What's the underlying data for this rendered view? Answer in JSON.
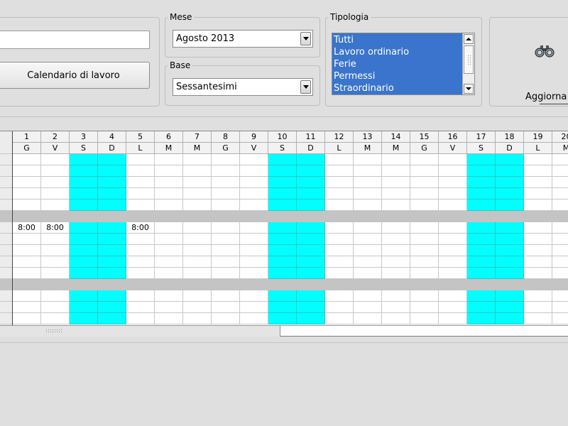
{
  "toolbar": {
    "name_input_value": "",
    "calendar_button_label": "Calendario di lavoro",
    "refresh_button_label": "Aggiorna",
    "refresh_icon": "binoculars-icon"
  },
  "mese": {
    "legend": "Mese",
    "selected": "Agosto 2013"
  },
  "base": {
    "legend": "Base",
    "selected": "Sessantesimi"
  },
  "tipologia": {
    "legend": "Tipologia",
    "items": [
      "Tutti",
      "Lavoro ordinario",
      "Ferie",
      "Permessi",
      "Straordinario"
    ]
  },
  "calendar": {
    "days": [
      {
        "num": "1",
        "dow": "G"
      },
      {
        "num": "2",
        "dow": "V"
      },
      {
        "num": "3",
        "dow": "S"
      },
      {
        "num": "4",
        "dow": "D"
      },
      {
        "num": "5",
        "dow": "L"
      },
      {
        "num": "6",
        "dow": "M"
      },
      {
        "num": "7",
        "dow": "M"
      },
      {
        "num": "8",
        "dow": "G"
      },
      {
        "num": "9",
        "dow": "V"
      },
      {
        "num": "10",
        "dow": "S"
      },
      {
        "num": "11",
        "dow": "D"
      },
      {
        "num": "12",
        "dow": "L"
      },
      {
        "num": "13",
        "dow": "M"
      },
      {
        "num": "14",
        "dow": "M"
      },
      {
        "num": "15",
        "dow": "G"
      },
      {
        "num": "16",
        "dow": "V"
      },
      {
        "num": "17",
        "dow": "S"
      },
      {
        "num": "18",
        "dow": "D"
      },
      {
        "num": "19",
        "dow": "L"
      },
      {
        "num": "20",
        "dow": "M"
      }
    ],
    "weekend_days": [
      "3",
      "4",
      "10",
      "11",
      "17",
      "18"
    ],
    "rows": [
      {
        "type": "data",
        "cells": {}
      },
      {
        "type": "data",
        "cells": {}
      },
      {
        "type": "data",
        "cells": {}
      },
      {
        "type": "data",
        "cells": {}
      },
      {
        "type": "data",
        "cells": {}
      },
      {
        "type": "separator"
      },
      {
        "type": "data",
        "cells": {
          "1": "8:00",
          "2": "8:00",
          "5": "8:00"
        }
      },
      {
        "type": "data",
        "cells": {}
      },
      {
        "type": "data",
        "cells": {}
      },
      {
        "type": "data",
        "cells": {}
      },
      {
        "type": "data",
        "cells": {}
      },
      {
        "type": "separator"
      },
      {
        "type": "data",
        "cells": {}
      },
      {
        "type": "data",
        "cells": {}
      },
      {
        "type": "data",
        "cells": {}
      }
    ]
  },
  "colors": {
    "weekend": "#00ffff",
    "separator": "#c4c4c4",
    "list_selection": "#3a74cc"
  }
}
